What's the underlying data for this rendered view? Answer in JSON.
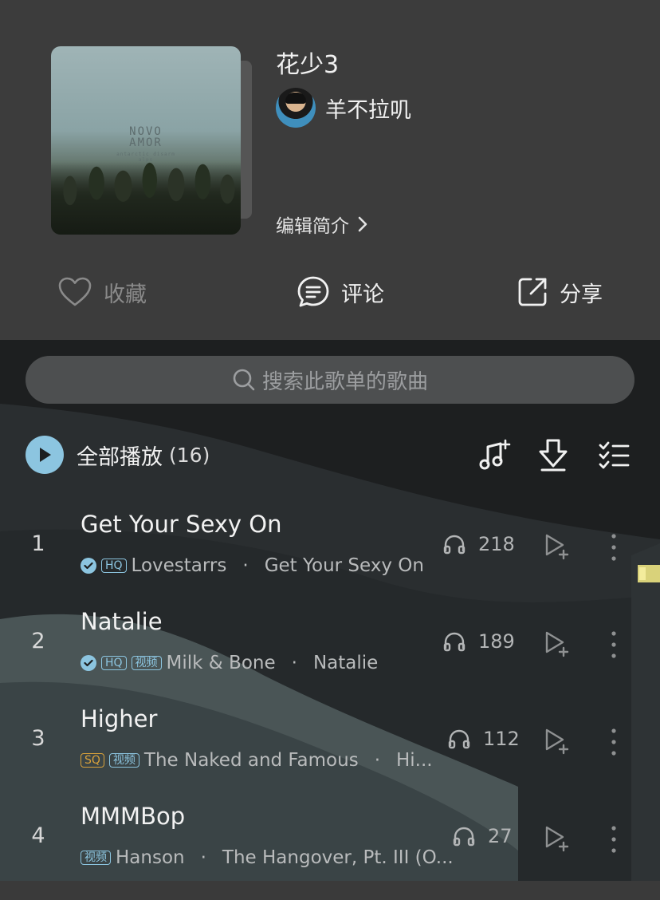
{
  "playlist": {
    "title": "花少3",
    "creator": "羊不拉叽",
    "edit_intro": "编辑简介",
    "cover_text": "NOVO\nAMOR",
    "cover_subtext": "antarctic disarm\nalps"
  },
  "actions": {
    "favorite": "收藏",
    "comment": "评论",
    "share": "分享"
  },
  "search": {
    "placeholder": "搜索此歌单的歌曲"
  },
  "play_all": {
    "label": "全部播放",
    "count": "(16)"
  },
  "colors": {
    "accent": "#8cc5e0",
    "sq": "#d9a23b",
    "header_bg": "#3c3c3c",
    "list_bg": "#1d1f20"
  },
  "songs": [
    {
      "index": "1",
      "title": "Get Your Sexy On",
      "verified": true,
      "badges": [
        "HQ"
      ],
      "artist": "Lovestarrs",
      "sep": "·",
      "album": "Get Your Sexy On",
      "plays": "218"
    },
    {
      "index": "2",
      "title": "Natalie",
      "verified": true,
      "badges": [
        "HQ",
        "视频"
      ],
      "artist": "Milk & Bone",
      "sep": "·",
      "album": "Natalie",
      "plays": "189"
    },
    {
      "index": "3",
      "title": "Higher",
      "verified": false,
      "badges": [
        "SQ",
        "视频"
      ],
      "artist": "The Naked and Famous",
      "sep": "·",
      "album": "Hi...",
      "plays": "112"
    },
    {
      "index": "4",
      "title": "MMMBop",
      "verified": false,
      "badges": [
        "视频"
      ],
      "artist": "Hanson",
      "sep": "·",
      "album": "The Hangover, Pt. III (O...",
      "plays": "27"
    }
  ]
}
